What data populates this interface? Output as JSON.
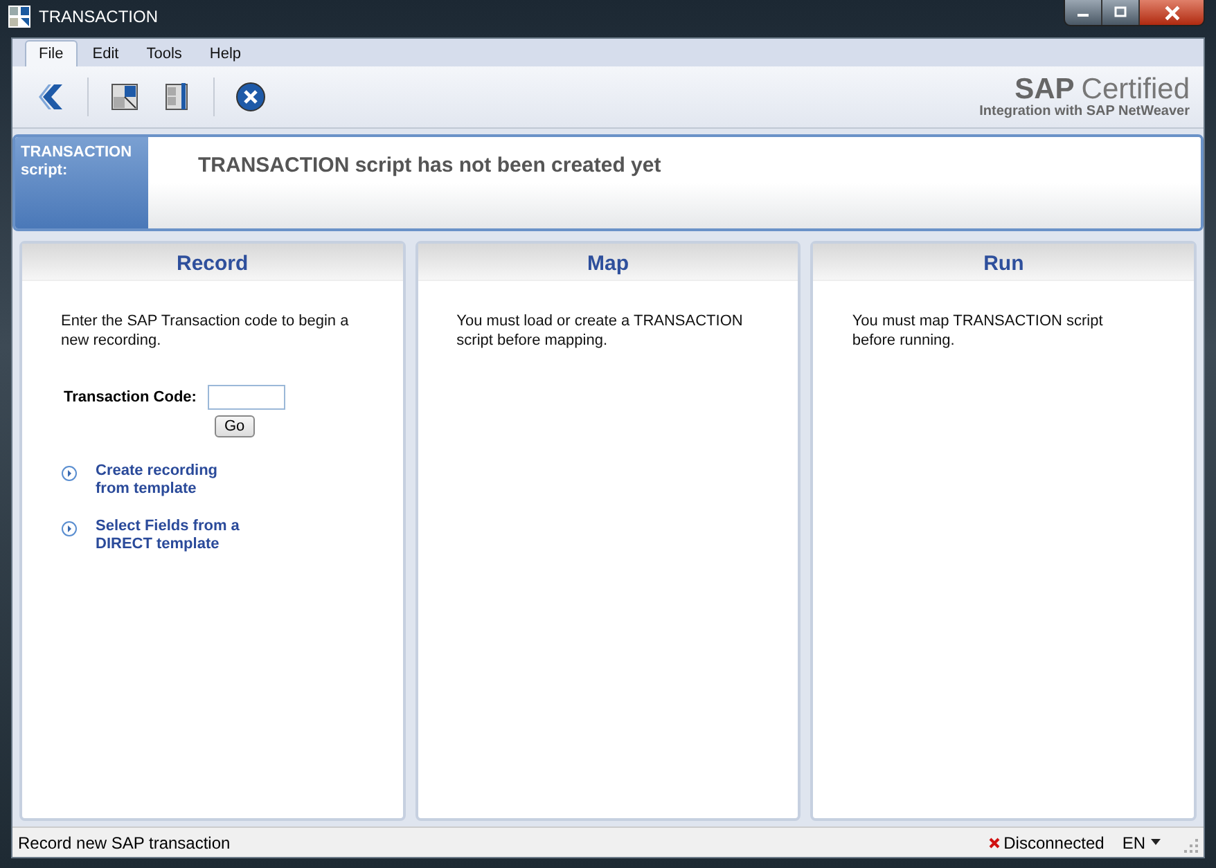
{
  "window": {
    "title": "TRANSACTION"
  },
  "menu": [
    {
      "label": "File",
      "selected": true
    },
    {
      "label": "Edit",
      "selected": false
    },
    {
      "label": "Tools",
      "selected": false
    },
    {
      "label": "Help",
      "selected": false
    }
  ],
  "logo": {
    "brand": "SAP",
    "word": "Certified",
    "tagline": "Integration with SAP NetWeaver"
  },
  "banner": {
    "label": "TRANSACTION script:",
    "message": "TRANSACTION script has not been created yet"
  },
  "panels": [
    {
      "kind": "form",
      "title": "Record",
      "text": "Enter the SAP Transaction code to begin a new recording.",
      "field_label": "Transaction Code:",
      "button": "Go",
      "links": [
        "Create recording from template",
        "Select Fields from a DIRECT template"
      ]
    },
    {
      "kind": "info",
      "title": "Map",
      "text": "You must load or create a TRANSACTION script before mapping."
    },
    {
      "kind": "info",
      "title": "Run",
      "text": "You must map TRANSACTION script before running."
    }
  ],
  "status_bar": {
    "text": "Record new SAP transaction",
    "connection": "Disconnected",
    "language": "EN"
  }
}
